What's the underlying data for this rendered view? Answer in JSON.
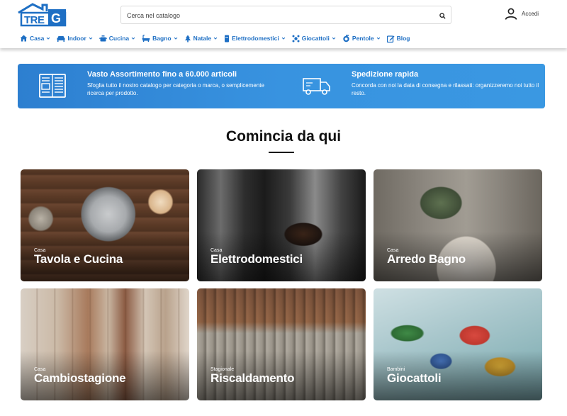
{
  "brand": {
    "logo_text": "TREG",
    "accent": "#1e6fc4",
    "banner_blue": "#3893e0"
  },
  "header": {
    "search": {
      "placeholder": "Cerca nel catalogo",
      "value": ""
    },
    "account_label": "Accedi"
  },
  "nav": {
    "items": [
      {
        "label": "Casa",
        "icon": "house-icon",
        "dropdown": true
      },
      {
        "label": "Indoor",
        "icon": "sofa-icon",
        "dropdown": true
      },
      {
        "label": "Cucina",
        "icon": "pot-icon",
        "dropdown": true
      },
      {
        "label": "Bagno",
        "icon": "bathtub-icon",
        "dropdown": true
      },
      {
        "label": "Natale",
        "icon": "christmas-tree-icon",
        "dropdown": true
      },
      {
        "label": "Elettrodomestici",
        "icon": "appliance-icon",
        "dropdown": true
      },
      {
        "label": "Giocattoli",
        "icon": "toy-icon",
        "dropdown": true
      },
      {
        "label": "Pentole",
        "icon": "pan-icon",
        "dropdown": true
      },
      {
        "label": "Blog",
        "icon": "edit-icon",
        "dropdown": false
      }
    ]
  },
  "banner": {
    "left": {
      "icon": "catalog-icon",
      "title": "Vasto Assortimento fino a 60.000 articoli",
      "text": "Sfoglia tutto il nostro catalogo per categoria o marca, o semplicemente ricerca per prodotto."
    },
    "right": {
      "icon": "delivery-truck-icon",
      "title": "Spedizione rapida",
      "text": "Concorda con noi la data di consegna e rilassati: organizzeremo noi tutto il resto."
    }
  },
  "section": {
    "title": "Comincia da qui"
  },
  "cards": [
    {
      "kicker": "Casa",
      "title": "Tavola e Cucina"
    },
    {
      "kicker": "Casa",
      "title": "Elettrodomestici"
    },
    {
      "kicker": "Casa",
      "title": "Arredo Bagno"
    },
    {
      "kicker": "Casa",
      "title": "Cambiostagione"
    },
    {
      "kicker": "Stagionale",
      "title": "Riscaldamento"
    },
    {
      "kicker": "Bambini",
      "title": "Giocattoli"
    }
  ]
}
